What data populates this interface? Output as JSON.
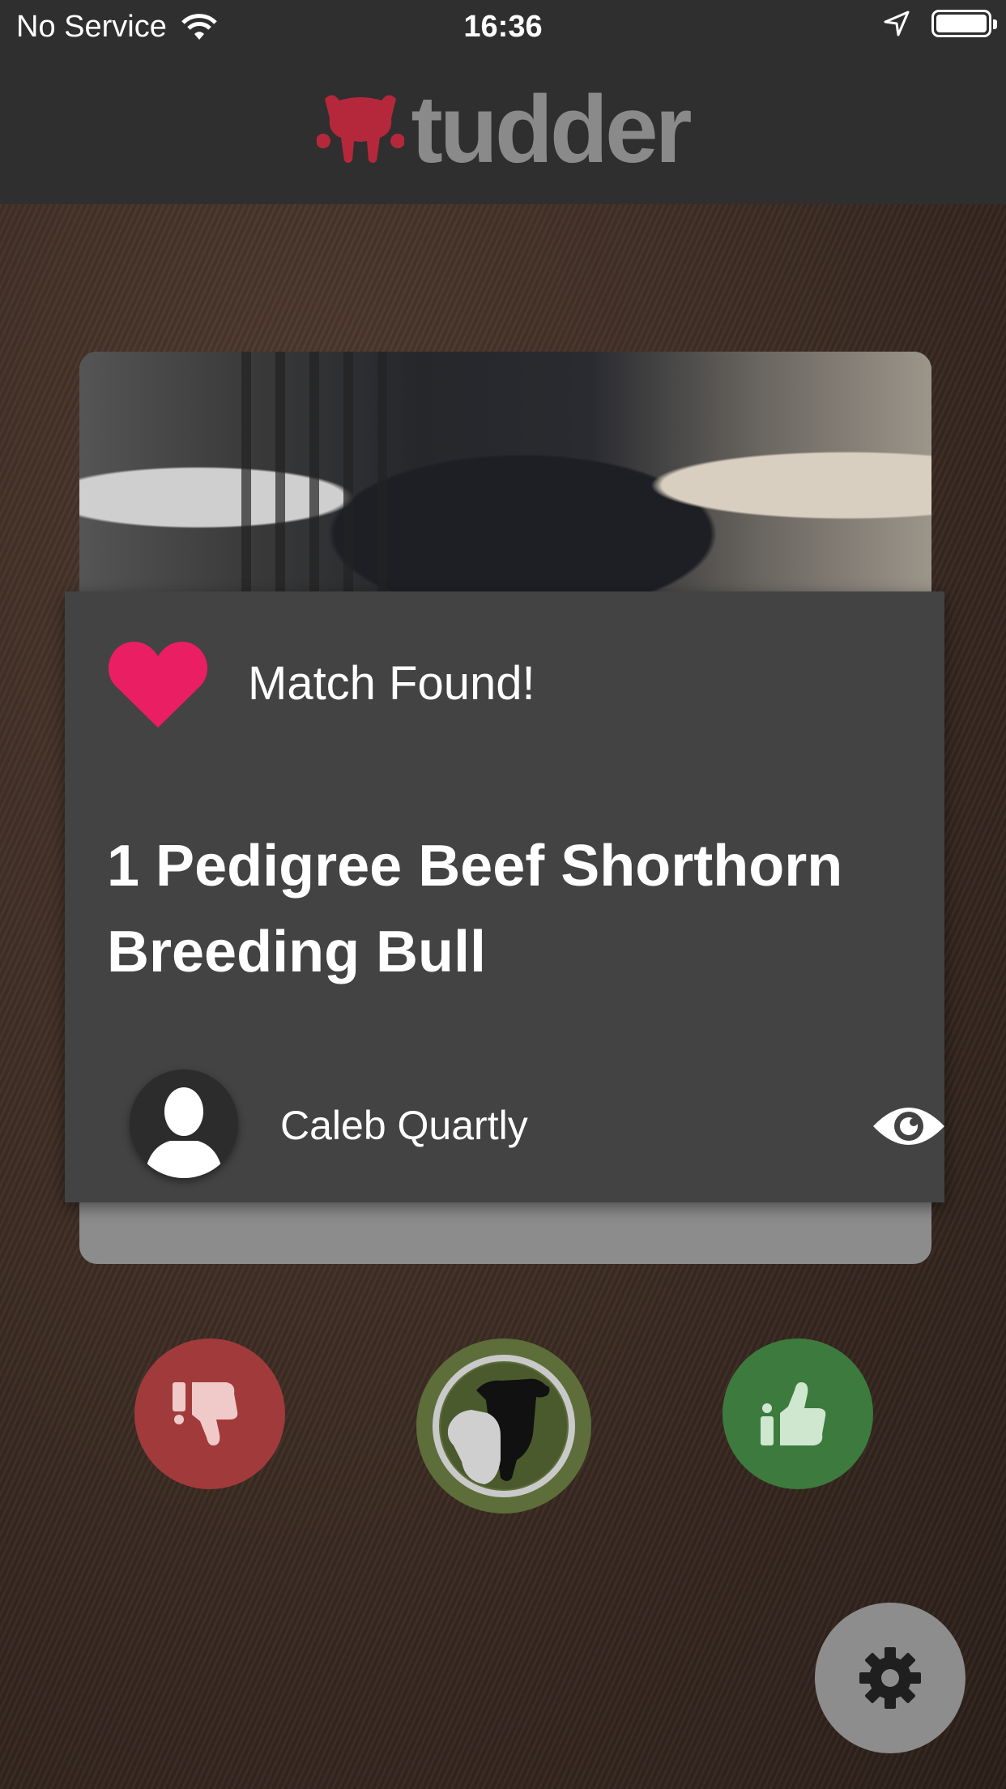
{
  "status_bar": {
    "carrier": "No Service",
    "time": "16:36"
  },
  "header": {
    "logo_text": "tudder"
  },
  "match_dialog": {
    "heading": "Match Found!",
    "listing_title": "1 Pedigree Beef Shorthorn Breeding Bull",
    "seller_name": "Caleb Quartly"
  },
  "actions": {
    "dislike_icon": "thumbs-down-icon",
    "cow_icon": "cow-heads-icon",
    "like_icon": "thumbs-up-icon",
    "settings_icon": "gear-icon"
  },
  "colors": {
    "heart": "#e91e63",
    "dislike": "#a13b3b",
    "like": "#3d7a3e",
    "brand_red": "#b5283c"
  }
}
